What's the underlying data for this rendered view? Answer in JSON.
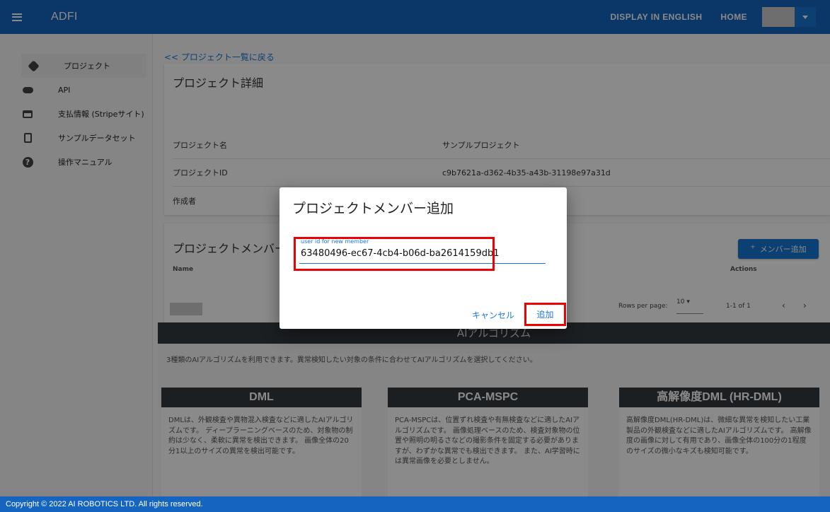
{
  "topbar": {
    "app_title": "ADFI",
    "display_english": "DISPLAY IN ENGLISH",
    "home": "HOME"
  },
  "sidebar": {
    "items": [
      {
        "label": "プロジェクト",
        "icon": "project-icon"
      },
      {
        "label": "API",
        "icon": "cloud-icon"
      },
      {
        "label": "支払情報 (Stripeサイト)",
        "icon": "credit-card-icon"
      },
      {
        "label": "サンプルデータセット",
        "icon": "file-download-icon"
      },
      {
        "label": "操作マニュアル",
        "icon": "help-icon"
      }
    ]
  },
  "main": {
    "back_link": "<< プロジェクト一覧に戻る",
    "detail_title": "プロジェクト詳細",
    "rows": [
      {
        "key": "プロジェクト名",
        "value": "サンプルプロジェクト"
      },
      {
        "key": "プロジェクトID",
        "value": "c9b7621a-d362-4b35-a43b-31198e97a31d"
      },
      {
        "key": "作成者",
        "value": ""
      }
    ],
    "member_title": "プロジェクトメンバー",
    "add_member": "メンバー追加",
    "col_name": "Name",
    "col_actions": "Actions",
    "rows_per_page_label": "Rows per page:",
    "rows_per_page": "10",
    "page_range": "1-1 of 1"
  },
  "algo": {
    "heading": "AIアルゴリズム",
    "desc": "3種類のAIアルゴリズムを利用できます。異常検知したい対象の条件に合わせてAIアルゴリズムを選択してください。",
    "cards": [
      {
        "title": "DML",
        "body": "DMLは、外観検査や異物混入検査などに適したAIアルゴリズムです。 ディープラーニングベースのため、対象物の制約は少なく、柔軟に異常を検出できます。 画像全体の20分1以上のサイズの異常を検出可能です。"
      },
      {
        "title": "PCA-MSPC",
        "body": "PCA-MSPCは、位置ずれ検査や有無検査などに適したAIアルゴリズムです。 画像処理ベースのため、検査対象物の位置や照明の明るさなどの撮影条件を固定する必要がありますが、わずかな異常でも検出できます。 また、AI学習時には異常画像を必要としません。"
      },
      {
        "title": "高解像度DML (HR-DML)",
        "body": "高解像度DML(HR-DML)は、微細な異常を検知したい工業製品の外観検査などに適したAIアルゴリズムです。 高解像度の画像に対して有用であり、画像全体の100分の1程度のサイズの微小なキズも検知可能です。"
      }
    ]
  },
  "dialog": {
    "title": "プロジェクトメンバー追加",
    "field_label": "user id for new member",
    "field_value": "63480496-ec67-4cb4-b06d-ba2614159db1",
    "cancel": "キャンセル",
    "add": "追加"
  },
  "footer": {
    "text": "Copyright © 2022 AI ROBOTICS LTD. All rights reserved."
  },
  "colors": {
    "primary": "#1565c0",
    "accent": "#1976d2",
    "highlight": "#e00000"
  }
}
